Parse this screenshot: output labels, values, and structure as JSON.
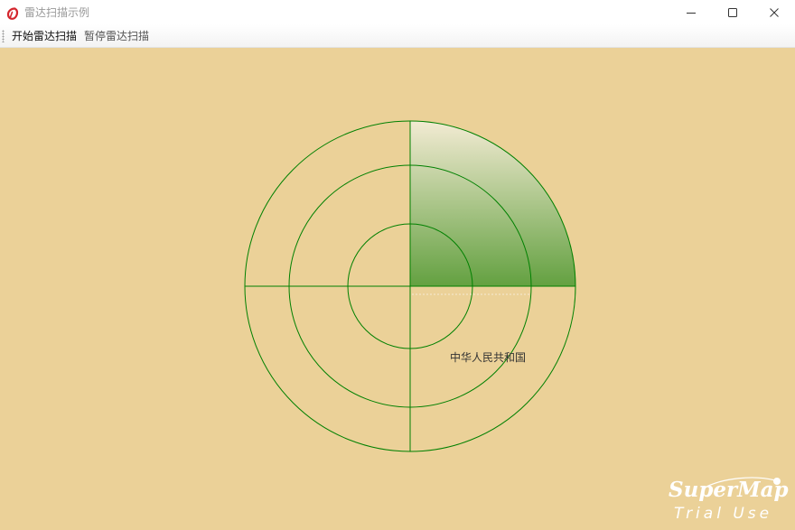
{
  "window": {
    "title": "雷达扫描示例",
    "controls": {
      "minimize": "minimize-icon",
      "maximize": "maximize-icon",
      "close": "close-icon"
    }
  },
  "toolbar": {
    "start_label": "开始雷达扫描",
    "pause_label": "暂停雷达扫描"
  },
  "map": {
    "background_color": "#ebd198",
    "radar_color": "#008000",
    "sweep_color": "#5c9e3c",
    "label": "中华人民共和国"
  },
  "watermark": {
    "brand": "SuperMap",
    "sub": "Trial Use"
  }
}
